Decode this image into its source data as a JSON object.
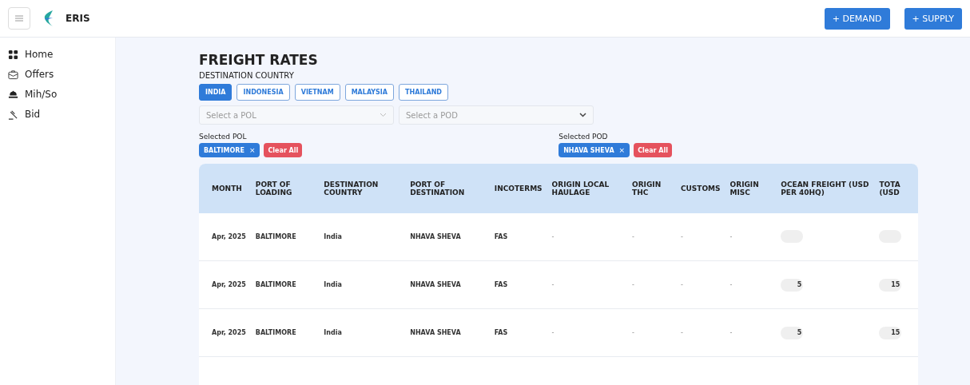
{
  "header": {
    "app_name": "ERIS",
    "buttons": [
      "+ DEMAND",
      "+ SUPPLY"
    ]
  },
  "sidebar": {
    "items": [
      {
        "label": "Home"
      },
      {
        "label": "Offers"
      },
      {
        "label": "Mih/So"
      },
      {
        "label": "Bid"
      }
    ]
  },
  "page": {
    "title": "FREIGHT RATES",
    "country_label": "DESTINATION COUNTRY",
    "countries": [
      {
        "label": "INDIA",
        "selected": true
      },
      {
        "label": "INDONESIA",
        "selected": false
      },
      {
        "label": "VIETNAM",
        "selected": false
      },
      {
        "label": "MALAYSIA",
        "selected": false
      },
      {
        "label": "THAILAND",
        "selected": false
      }
    ],
    "pol_select": {
      "placeholder": "Select a POL"
    },
    "pod_select": {
      "placeholder": "Select a POD"
    },
    "selected_pol": {
      "label": "Selected POL",
      "chips": [
        {
          "label": "BALTIMORE",
          "remove": "×"
        }
      ],
      "clear": "Clear All"
    },
    "selected_pod": {
      "label": "Selected POD",
      "chips": [
        {
          "label": "NHAVA SHEVA",
          "remove": "×"
        }
      ],
      "clear": "Clear All"
    }
  },
  "table": {
    "columns": [
      "MONTH",
      "PORT OF LOADING",
      "DESTINATION COUNTRY",
      "PORT OF DESTINATION",
      "INCOTERMS",
      "ORIGIN LOCAL HAULAGE",
      "ORIGIN THC",
      "CUSTOMS",
      "ORIGIN MISC",
      "OCEAN FREIGHT (USD PER 40HQ)",
      "TOTA (USD"
    ],
    "rows": [
      {
        "cells": [
          {
            "text": "Apr, 2025"
          },
          {
            "text": "BALTIMORE"
          },
          {
            "text": "India"
          },
          {
            "text": "NHAVA SHEVA"
          },
          {
            "text": "FAS"
          },
          {
            "text": "-"
          },
          {
            "text": "-"
          },
          {
            "text": "-"
          },
          {
            "text": "-"
          },
          {
            "blurred": true
          },
          {
            "blurred": true
          }
        ]
      },
      {
        "cells": [
          {
            "text": "Apr, 2025"
          },
          {
            "text": "BALTIMORE"
          },
          {
            "text": "India"
          },
          {
            "text": "NHAVA SHEVA"
          },
          {
            "text": "FAS"
          },
          {
            "text": "-"
          },
          {
            "text": "-"
          },
          {
            "text": "-"
          },
          {
            "text": "-"
          },
          {
            "text": "5",
            "blurred": true
          },
          {
            "text": "15",
            "blurred": true
          }
        ]
      },
      {
        "cells": [
          {
            "text": "Apr, 2025"
          },
          {
            "text": "BALTIMORE"
          },
          {
            "text": "India"
          },
          {
            "text": "NHAVA SHEVA"
          },
          {
            "text": "FAS"
          },
          {
            "text": "-"
          },
          {
            "text": "-"
          },
          {
            "text": "-"
          },
          {
            "text": "-"
          },
          {
            "text": "5",
            "blurred": true
          },
          {
            "text": "15",
            "blurred": true
          }
        ]
      }
    ]
  }
}
